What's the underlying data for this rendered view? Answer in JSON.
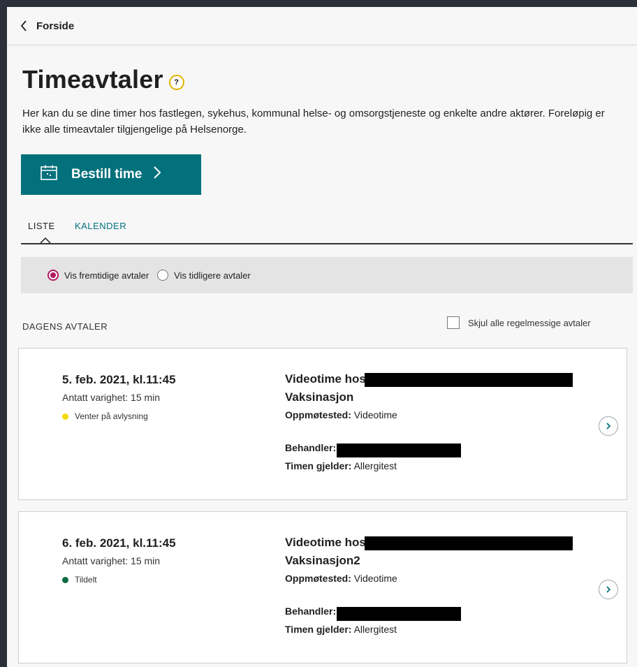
{
  "nav": {
    "back_label": "Forside"
  },
  "header": {
    "title": "Timeavtaler",
    "help_symbol": "?",
    "intro": "Her kan du se dine timer hos fastlegen, sykehus, kommunal helse- og omsorgstjeneste og enkelte andre aktører. Foreløpig er ikke alle timeavtaler tilgjengelige på Helsenorge."
  },
  "cta": {
    "label": "Bestill time"
  },
  "tabs": [
    {
      "label": "LISTE",
      "active": true
    },
    {
      "label": "KALENDER",
      "active": false
    }
  ],
  "filter": {
    "options": [
      {
        "label": "Vis fremtidige avtaler",
        "selected": true
      },
      {
        "label": "Vis tidligere avtaler",
        "selected": false
      }
    ]
  },
  "section": {
    "label": "DAGENS AVTALER",
    "hide_recurring_label": "Skjul alle regelmessige avtaler"
  },
  "labels": {
    "place": "Oppmøtested:",
    "handler": "Behandler:",
    "concerns": "Timen gjelder:"
  },
  "appointments": [
    {
      "date": "5. feb. 2021, kl.11:45",
      "duration": "Antatt varighet: 15 min",
      "status": "Venter på avlysning",
      "status_color": "#f5d90a",
      "type": "Videotime hos",
      "name": "Vaksinasjon",
      "place": "Videotime",
      "concerns": "Allergitest"
    },
    {
      "date": "6. feb. 2021, kl.11:45",
      "duration": "Antatt varighet: 15 min",
      "status": "Tildelt",
      "status_color": "#0a6b3f",
      "type": "Videotime hos",
      "name": "Vaksinasjon2",
      "place": "Videotime",
      "concerns": "Allergitest"
    }
  ],
  "colors": {
    "brand": "#03717c",
    "radio_accent": "#b2195f"
  }
}
